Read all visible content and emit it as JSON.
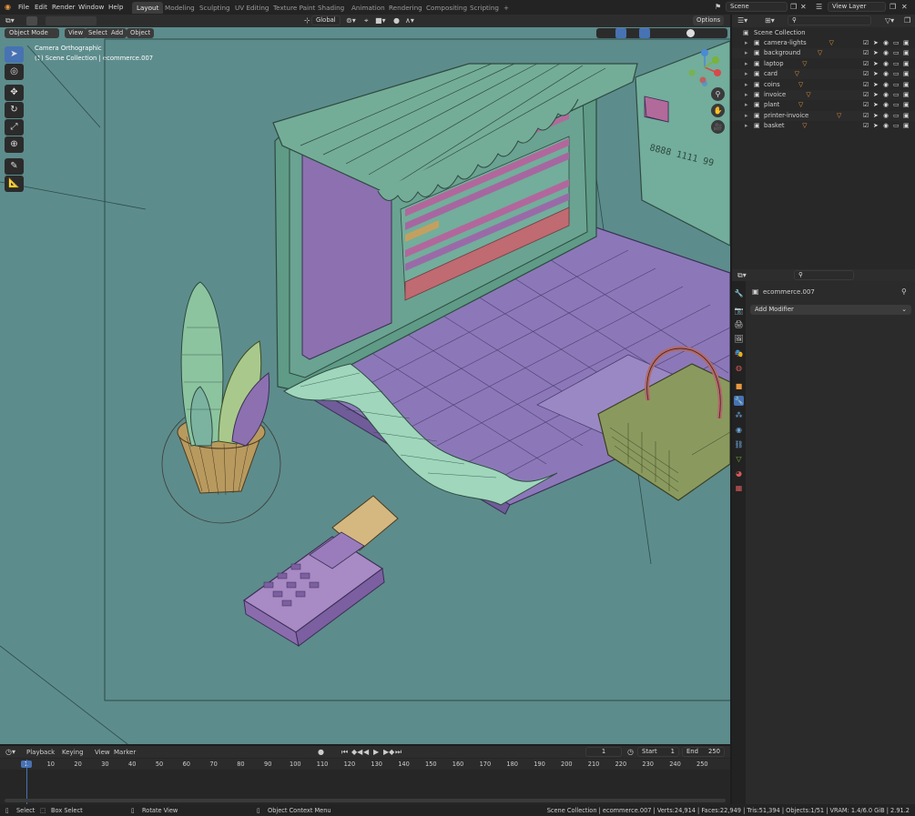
{
  "topbar": {
    "menus": [
      "File",
      "Edit",
      "Render",
      "Window",
      "Help"
    ],
    "workspaces": [
      "Layout",
      "Modeling",
      "Sculpting",
      "UV Editing",
      "Texture Paint",
      "Shading",
      "Animation",
      "Rendering",
      "Compositing",
      "Scripting"
    ],
    "active_workspace": "Layout",
    "add_tab": "+",
    "scene": "Scene",
    "view_layer": "View Layer"
  },
  "viewport_header": {
    "mode": "Object Mode",
    "menus": [
      "View",
      "Select",
      "Add",
      "Object"
    ],
    "transform_orientation": "Global",
    "options": "Options"
  },
  "viewport": {
    "camera_label": "Camera Orthographic",
    "collection_label": "(1) Scene Collection | ecommerce.007",
    "card_number": "8888 1111 99"
  },
  "outliner": {
    "root": "Scene Collection",
    "items": [
      "camera-lights",
      "background",
      "laptop",
      "card",
      "coins",
      "invoice",
      "plant",
      "printer-invoice",
      "basket"
    ]
  },
  "properties": {
    "object_name": "ecommerce.007",
    "add_modifier": "Add Modifier"
  },
  "timeline": {
    "menus": [
      "Playback",
      "Keying",
      "View",
      "Marker"
    ],
    "current_frame": "1",
    "start_label": "Start",
    "start": "1",
    "end_label": "End",
    "end": "250",
    "ruler": [
      "1",
      "10",
      "20",
      "30",
      "40",
      "50",
      "60",
      "70",
      "80",
      "90",
      "100",
      "110",
      "120",
      "130",
      "140",
      "150",
      "160",
      "170",
      "180",
      "190",
      "200",
      "210",
      "220",
      "230",
      "240",
      "250"
    ]
  },
  "statusbar": {
    "select": "Select",
    "box_select": "Box Select",
    "rotate_view": "Rotate View",
    "context_menu": "Object Context Menu",
    "stats": "Scene Collection | ecommerce.007 | Verts:24,914 | Faces:22,949 | Tris:51,394 | Objects:1/51 | VRAM: 1.4/6.0 GiB | 2.91.2"
  },
  "colors": {
    "viewport_bg": "#5d8c8c",
    "accent": "#4772b3",
    "object_orange": "#e9973e"
  }
}
